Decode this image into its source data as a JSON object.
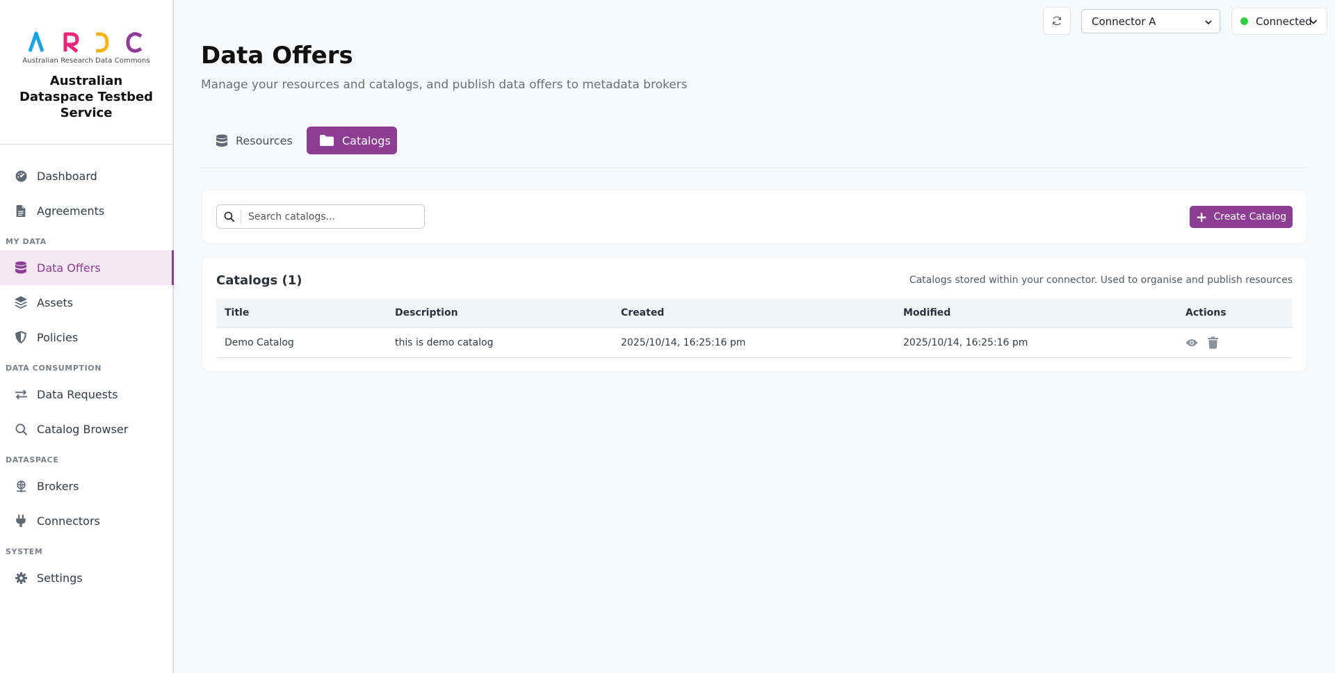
{
  "brand": {
    "logo_letters": [
      "A",
      "R",
      "D",
      "C"
    ],
    "logo_subtitle": "Australian Research Data Commons",
    "title": "Australian Dataspace Testbed Service"
  },
  "sidebar": {
    "items": [
      {
        "label": "Dashboard",
        "icon": "gauge-icon"
      },
      {
        "label": "Agreements",
        "icon": "document-icon"
      }
    ],
    "sections": [
      {
        "title": "MY DATA",
        "items": [
          {
            "label": "Data Offers",
            "icon": "database-icon",
            "active": true
          },
          {
            "label": "Assets",
            "icon": "layers-icon"
          },
          {
            "label": "Policies",
            "icon": "shield-icon"
          }
        ]
      },
      {
        "title": "DATA CONSUMPTION",
        "items": [
          {
            "label": "Data Requests",
            "icon": "arrows-exchange-icon"
          },
          {
            "label": "Catalog Browser",
            "icon": "search-icon"
          }
        ]
      },
      {
        "title": "DATASPACE",
        "items": [
          {
            "label": "Brokers",
            "icon": "network-icon"
          },
          {
            "label": "Connectors",
            "icon": "plug-icon"
          }
        ]
      },
      {
        "title": "SYSTEM",
        "items": [
          {
            "label": "Settings",
            "icon": "gear-icon"
          }
        ]
      }
    ]
  },
  "topbar": {
    "refresh_icon": "refresh-icon",
    "connector_selected": "Connector A",
    "status_label": "Connected",
    "status_color": "#2ecc40"
  },
  "header": {
    "title": "Data Offers",
    "subtitle": "Manage your resources and catalogs, and publish data offers to metadata brokers"
  },
  "tabs": [
    {
      "label": "Resources",
      "icon": "database-icon",
      "active": false
    },
    {
      "label": "Catalogs",
      "icon": "folder-icon",
      "active": true
    }
  ],
  "search": {
    "placeholder": "Search catalogs..."
  },
  "create_button": {
    "label": "Create Catalog"
  },
  "catalogs": {
    "title": "Catalogs (1)",
    "note": "Catalogs stored within your connector. Used to organise and publish resources",
    "columns": [
      "Title",
      "Description",
      "Created",
      "Modified",
      "Actions"
    ],
    "rows": [
      {
        "title": "Demo Catalog",
        "description": "this is demo catalog",
        "created": "2025/10/14, 16:25:16 pm",
        "modified": "2025/10/14, 16:25:16 pm"
      }
    ]
  },
  "colors": {
    "accent": "#8e3d95",
    "logo_a": "#1aa3e0",
    "logo_r": "#e6287a",
    "logo_d": "#f5b21a",
    "logo_c": "#8e3d95"
  }
}
